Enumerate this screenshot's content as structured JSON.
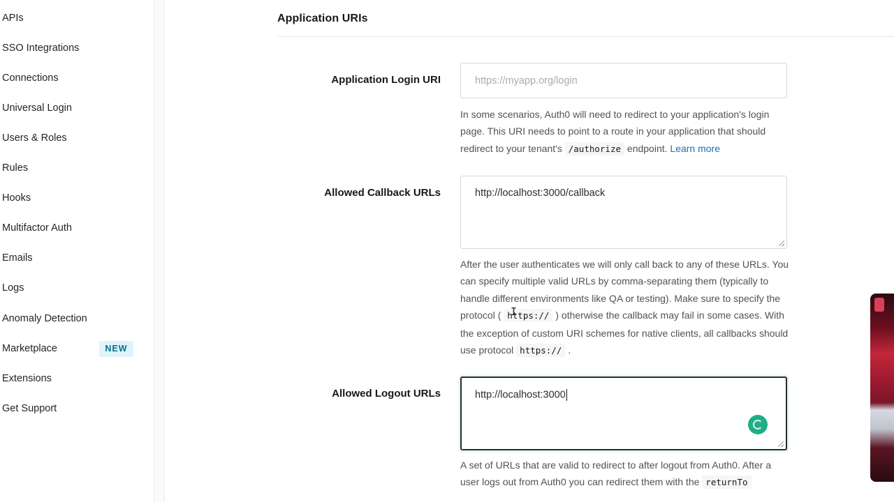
{
  "sidebar": {
    "items": [
      {
        "label": "APIs"
      },
      {
        "label": "SSO Integrations"
      },
      {
        "label": "Connections"
      },
      {
        "label": "Universal Login"
      },
      {
        "label": "Users & Roles"
      },
      {
        "label": "Rules"
      },
      {
        "label": "Hooks"
      },
      {
        "label": "Multifactor Auth"
      },
      {
        "label": "Emails"
      },
      {
        "label": "Logs"
      },
      {
        "label": "Anomaly Detection"
      },
      {
        "label": "Marketplace",
        "badge": "NEW"
      },
      {
        "label": "Extensions"
      },
      {
        "label": "Get Support"
      }
    ]
  },
  "section": {
    "title": "Application URIs"
  },
  "fields": {
    "login_uri": {
      "label": "Application Login URI",
      "value": "",
      "placeholder": "https://myapp.org/login",
      "help_part1": "In some scenarios, Auth0 will need to redirect to your application's login page. This URI needs to point to a route in your application that should redirect to your tenant's ",
      "help_code": "/authorize",
      "help_part2": " endpoint. ",
      "help_link": "Learn more"
    },
    "callback_urls": {
      "label": "Allowed Callback URLs",
      "value": "http://localhost:3000/callback",
      "help_part1": "After the user authenticates we will only call back to any of these URLs. You can specify multiple valid URLs by comma-separating them (typically to handle different environments like QA or testing). Make sure to specify the protocol ( ",
      "help_code1": "https://",
      "help_part2": " ) otherwise the callback may fail in some cases. With the exception of custom URI schemes for native clients, all callbacks should use protocol ",
      "help_code2": "https://",
      "help_part3": " ."
    },
    "logout_urls": {
      "label": "Allowed Logout URLs",
      "value": "http://localhost:3000",
      "help_part1": "A set of URLs that are valid to redirect to after logout from Auth0. After a user logs out from Auth0 you can redirect them with the ",
      "help_code": "returnTo"
    }
  },
  "colors": {
    "badge_bg": "#dff3fa",
    "badge_text": "#0a6f92",
    "link": "#1a6fb8",
    "spinner": "#1fae86"
  },
  "icons": {
    "spinner": "loading-spinner-icon",
    "resize": "resize-grip-icon"
  }
}
